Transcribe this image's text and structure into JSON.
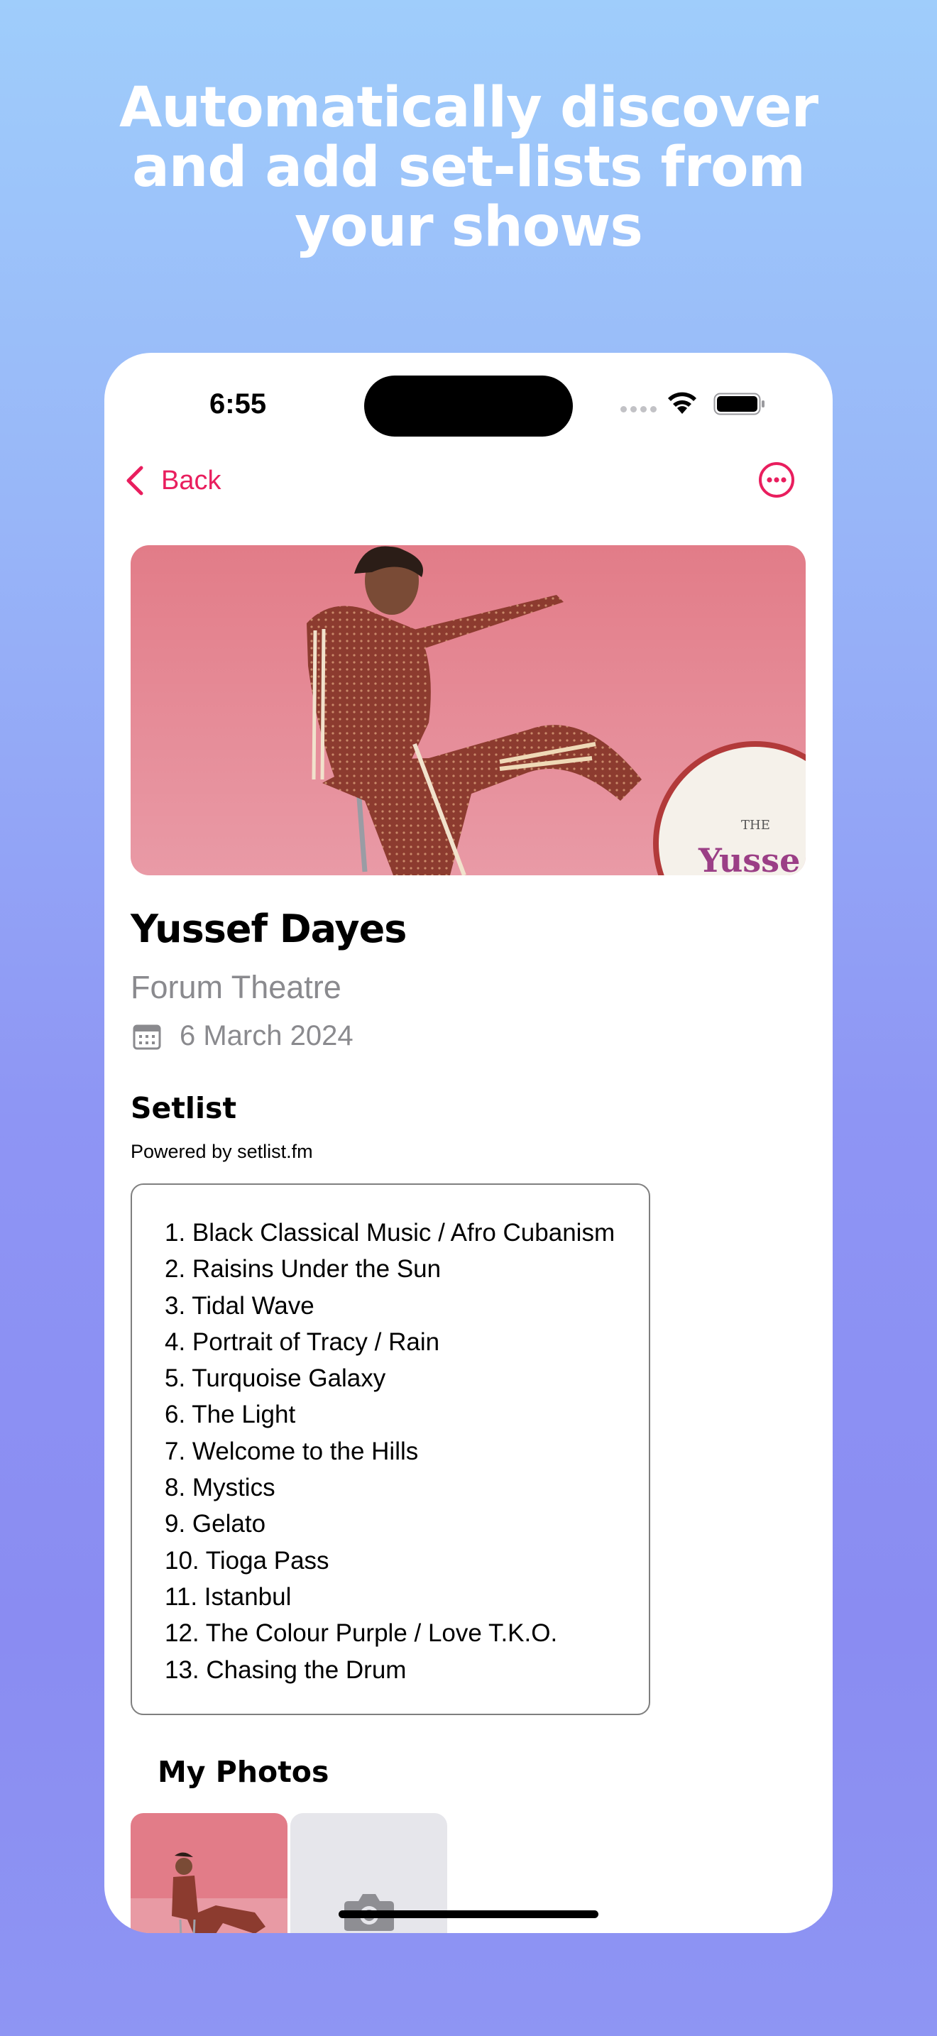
{
  "headline": {
    "line1": "Automatically discover",
    "line2": "and add set-lists from",
    "line3": "your shows"
  },
  "status_bar": {
    "time": "6:55",
    "icons": [
      "signal-icon",
      "wifi-icon",
      "battery-icon"
    ]
  },
  "nav": {
    "back_label": "Back",
    "back_icon": "chevron-left-icon",
    "more_icon": "ellipsis-circle-icon"
  },
  "event": {
    "artist": "Yussef Dayes",
    "venue": "Forum Theatre",
    "date": "6 March 2024",
    "date_icon": "calendar-icon"
  },
  "setlist": {
    "title": "Setlist",
    "powered_by": "Powered by setlist.fm",
    "songs": [
      "1. Black Classical Music / Afro Cubanism",
      "2. Raisins Under the Sun",
      "3. Tidal Wave",
      "4. Portrait of Tracy / Rain",
      "5. Turquoise Galaxy",
      "6. The Light",
      "7. Welcome to the Hills",
      "8. Mystics",
      "9. Gelato",
      "10. Tioga Pass",
      "11. Istanbul",
      "12. The Colour Purple / Love T.K.O.",
      "13. Chasing the Drum"
    ]
  },
  "photos": {
    "title": "My Photos",
    "add_icon": "camera-icon"
  },
  "colors": {
    "accent": "#e91e5e",
    "secondary_text": "#8a8a8e",
    "hero_background": "#e07a86"
  }
}
